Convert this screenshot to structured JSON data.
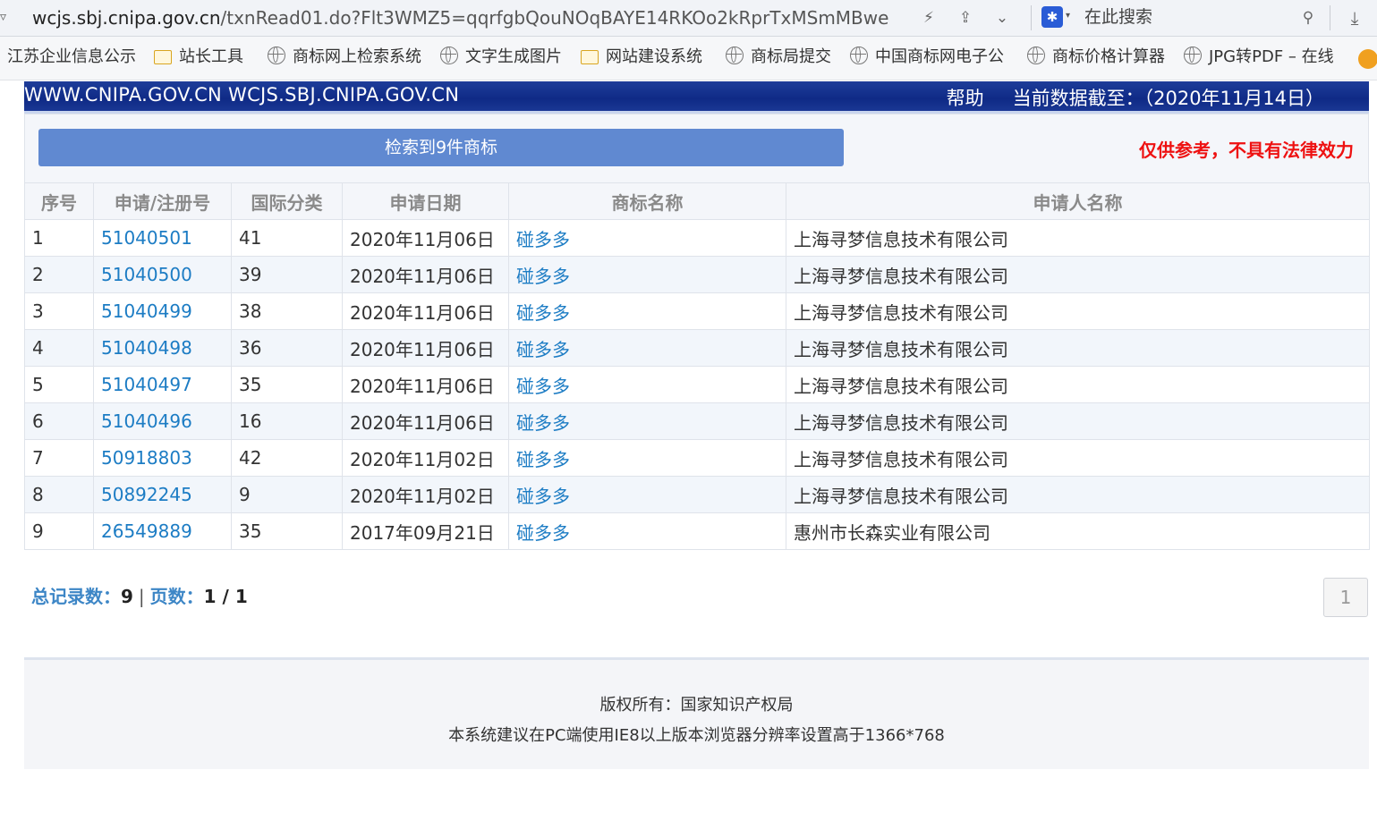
{
  "browser": {
    "url_domain": "wcjs.sbj.cnipa.gov.cn",
    "url_rest": "/txnRead01.do?Flt3WMZ5=qqrfgbQouNOqBAYE14RKOo2kRprTxMSmMBwe",
    "search_placeholder": "在此搜索",
    "bookmarks": [
      {
        "label": "江苏企业信息公示",
        "icon": "none"
      },
      {
        "label": "站长工具",
        "icon": "folder-icon"
      },
      {
        "label": "商标网上检索系统",
        "icon": "globe-icon"
      },
      {
        "label": "文字生成图片",
        "icon": "globe-icon"
      },
      {
        "label": "网站建设系统",
        "icon": "folder-icon"
      },
      {
        "label": "商标局提交",
        "icon": "globe-icon"
      },
      {
        "label": "中国商标网电子公",
        "icon": "globe-icon"
      },
      {
        "label": "商标价格计算器",
        "icon": "globe-icon"
      },
      {
        "label": "JPG转PDF – 在线",
        "icon": "globe-icon"
      }
    ]
  },
  "site": {
    "domains": "WWW.CNIPA.GOV.CN WCJS.SBJ.CNIPA.GOV.CN",
    "help": "帮助",
    "data_date": "当前数据截至：（2020年11月14日）"
  },
  "result": {
    "button_label": "检索到9件商标",
    "disclaimer": "仅供参考，不具有法律效力"
  },
  "table": {
    "headers": [
      "序号",
      "申请/注册号",
      "国际分类",
      "申请日期",
      "商标名称",
      "申请人名称"
    ],
    "rows": [
      [
        "1",
        "51040501",
        "41",
        "2020年11月06日",
        "碰多多",
        "上海寻梦信息技术有限公司"
      ],
      [
        "2",
        "51040500",
        "39",
        "2020年11月06日",
        "碰多多",
        "上海寻梦信息技术有限公司"
      ],
      [
        "3",
        "51040499",
        "38",
        "2020年11月06日",
        "碰多多",
        "上海寻梦信息技术有限公司"
      ],
      [
        "4",
        "51040498",
        "36",
        "2020年11月06日",
        "碰多多",
        "上海寻梦信息技术有限公司"
      ],
      [
        "5",
        "51040497",
        "35",
        "2020年11月06日",
        "碰多多",
        "上海寻梦信息技术有限公司"
      ],
      [
        "6",
        "51040496",
        "16",
        "2020年11月06日",
        "碰多多",
        "上海寻梦信息技术有限公司"
      ],
      [
        "7",
        "50918803",
        "42",
        "2020年11月02日",
        "碰多多",
        "上海寻梦信息技术有限公司"
      ],
      [
        "8",
        "50892245",
        "9",
        "2020年11月02日",
        "碰多多",
        "上海寻梦信息技术有限公司"
      ],
      [
        "9",
        "26549889",
        "35",
        "2017年09月21日",
        "碰多多",
        "惠州市长森实业有限公司"
      ]
    ]
  },
  "pager": {
    "total_label": "总记录数：",
    "total": "9",
    "separator": "|",
    "pages_label": "页数：",
    "pages": "1 / 1",
    "current_page": "1"
  },
  "footer": {
    "line1": "版权所有：国家知识产权局",
    "line2": "本系统建议在PC端使用IE8以上版本浏览器分辨率设置高于1366*768"
  },
  "colors": {
    "header_blue": "#1e3d9a",
    "result_button": "#6089d1",
    "disclaimer_red": "#ee1111",
    "link_blue": "#1c7cc4"
  }
}
